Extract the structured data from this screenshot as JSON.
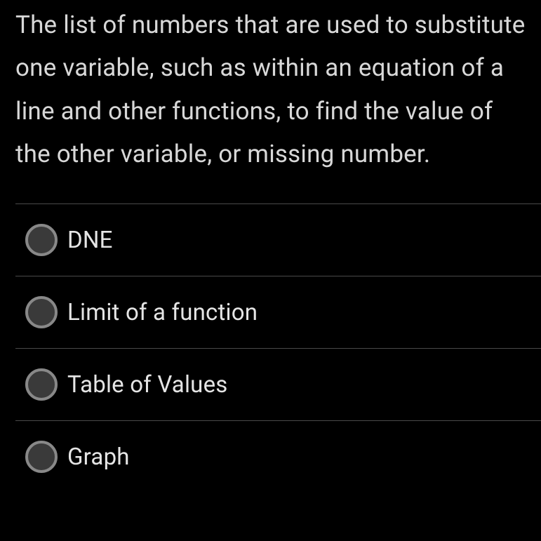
{
  "question": {
    "text": "The list of numbers that are used to substitute one variable, such as within an equation of a line and other functions, to find the value of the other variable, or missing number."
  },
  "options": [
    {
      "label": "DNE"
    },
    {
      "label": "Limit of a function"
    },
    {
      "label": "Table of Values"
    },
    {
      "label": "Graph"
    }
  ]
}
